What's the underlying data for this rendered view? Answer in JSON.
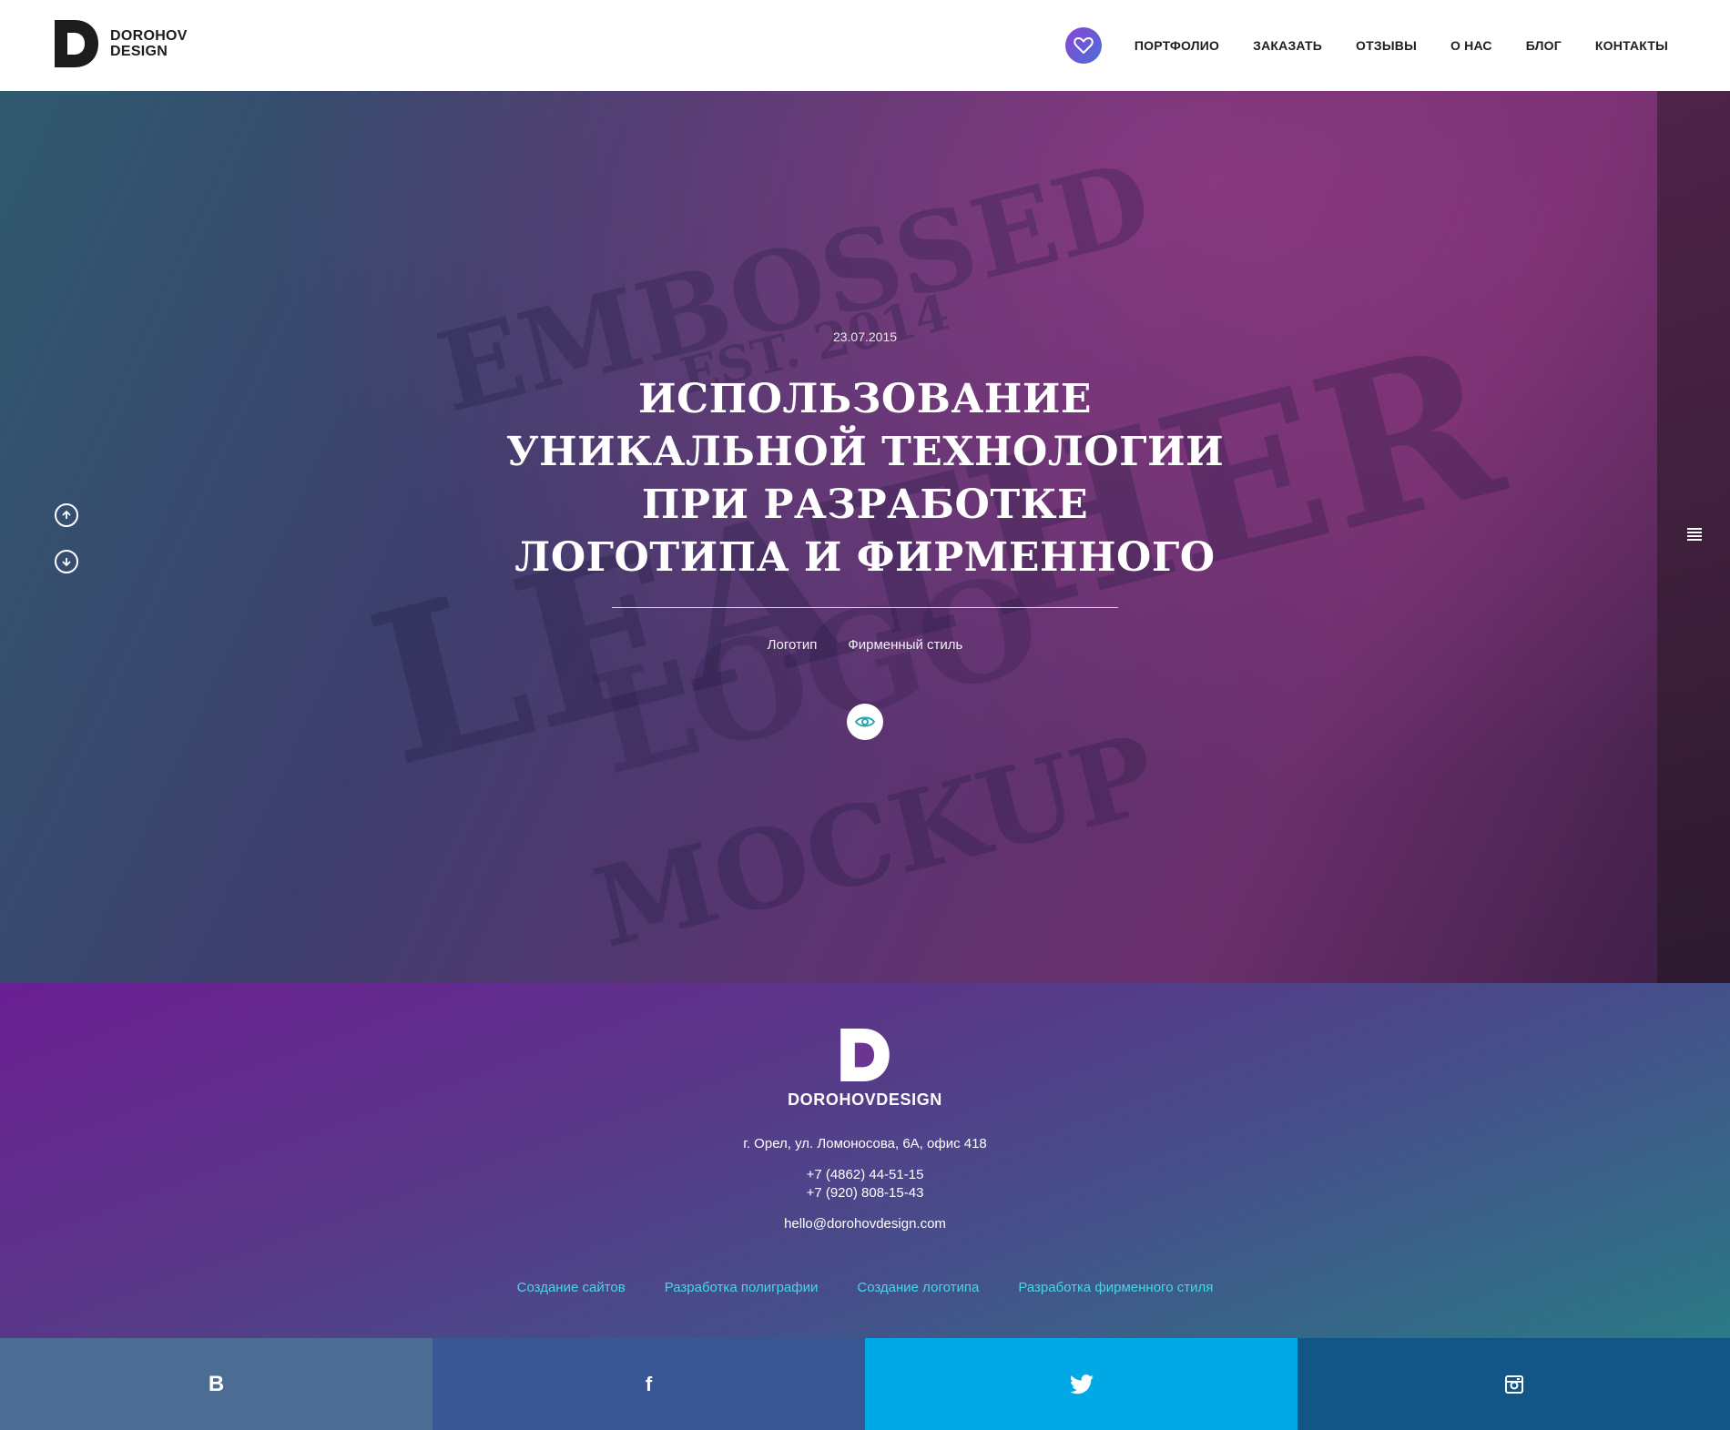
{
  "header": {
    "logo_line1": "DOROHOV",
    "logo_line2": "DESIGN",
    "nav": [
      "ПОРТФОЛИО",
      "ЗАКАЗАТЬ",
      "ОТЗЫВЫ",
      "О НАС",
      "БЛОГ",
      "КОНТАКТЫ"
    ]
  },
  "hero": {
    "date": "23.07.2015",
    "title_lines": [
      "ИСПОЛЬЗОВАНИЕ",
      "УНИКАЛЬНОЙ ТЕХНОЛОГИИ",
      "ПРИ РАЗРАБОТКЕ",
      "ЛОГОТИПА И ФИРМЕННОГО"
    ],
    "tags": [
      "Логотип",
      "Фирменный стиль"
    ],
    "background_text": {
      "embossed": "EMBOSSED",
      "est": "EST. 2014",
      "leather": "LEATHER",
      "logo": "LOGO",
      "mockup": "MOCKUP"
    }
  },
  "footer": {
    "brand": "DOROHOVDESIGN",
    "address": "г. Орел, ул. Ломоносова, 6А, офис 418",
    "phone1": "+7 (4862) 44-51-15",
    "phone2": "+7 (920) 808-15-43",
    "email": "hello@dorohovdesign.com",
    "links": [
      "Создание сайтов",
      "Разработка полиграфии",
      "Создание логотипа",
      "Разработка фирменного стиля"
    ]
  },
  "social": {
    "vk_glyph": "B",
    "fb_glyph": "f",
    "icons": [
      "vk-icon",
      "facebook-icon",
      "twitter-icon",
      "instagram-icon"
    ]
  },
  "colors": {
    "accent_gradient_start": "#8a45d6",
    "accent_gradient_end": "#4b6fd6",
    "footer_link": "#45d7e8",
    "vk": "#4c6c93",
    "facebook": "#3a5795",
    "twitter": "#00a8e6",
    "instagram": "#125688"
  }
}
